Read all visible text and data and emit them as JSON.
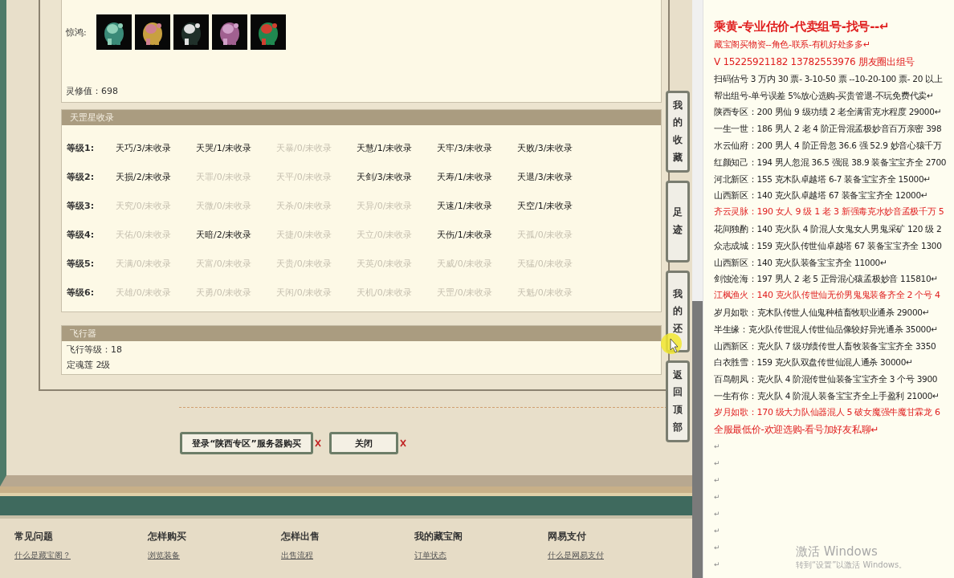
{
  "profile": {
    "set_label": "惊鸿:",
    "spirit": "灵修值：698"
  },
  "collection": {
    "title": "天罡星收录",
    "rows": [
      {
        "label": "等级1:",
        "cells": [
          {
            "text": "天巧/3/未收录",
            "collected": true
          },
          {
            "text": "天哭/1/未收录",
            "collected": true
          },
          {
            "text": "天暴/0/未收录",
            "collected": false
          },
          {
            "text": "天慧/1/未收录",
            "collected": true
          },
          {
            "text": "天牢/3/未收录",
            "collected": true
          },
          {
            "text": "天败/3/未收录",
            "collected": true
          }
        ]
      },
      {
        "label": "等级2:",
        "cells": [
          {
            "text": "天损/2/未收录",
            "collected": true
          },
          {
            "text": "天罪/0/未收录",
            "collected": false
          },
          {
            "text": "天平/0/未收录",
            "collected": false
          },
          {
            "text": "天剑/3/未收录",
            "collected": true
          },
          {
            "text": "天寿/1/未收录",
            "collected": true
          },
          {
            "text": "天退/3/未收录",
            "collected": true
          }
        ]
      },
      {
        "label": "等级3:",
        "cells": [
          {
            "text": "天究/0/未收录",
            "collected": false
          },
          {
            "text": "天微/0/未收录",
            "collected": false
          },
          {
            "text": "天杀/0/未收录",
            "collected": false
          },
          {
            "text": "天异/0/未收录",
            "collected": false
          },
          {
            "text": "天速/1/未收录",
            "collected": true
          },
          {
            "text": "天空/1/未收录",
            "collected": true
          }
        ]
      },
      {
        "label": "等级4:",
        "cells": [
          {
            "text": "天佑/0/未收录",
            "collected": false
          },
          {
            "text": "天暗/2/未收录",
            "collected": true
          },
          {
            "text": "天捷/0/未收录",
            "collected": false
          },
          {
            "text": "天立/0/未收录",
            "collected": false
          },
          {
            "text": "天伤/1/未收录",
            "collected": true
          },
          {
            "text": "天孤/0/未收录",
            "collected": false
          }
        ]
      },
      {
        "label": "等级5:",
        "cells": [
          {
            "text": "天满/0/未收录",
            "collected": false
          },
          {
            "text": "天富/0/未收录",
            "collected": false
          },
          {
            "text": "天贵/0/未收录",
            "collected": false
          },
          {
            "text": "天英/0/未收录",
            "collected": false
          },
          {
            "text": "天威/0/未收录",
            "collected": false
          },
          {
            "text": "天猛/0/未收录",
            "collected": false
          }
        ]
      },
      {
        "label": "等级6:",
        "cells": [
          {
            "text": "天雄/0/未收录",
            "collected": false
          },
          {
            "text": "天勇/0/未收录",
            "collected": false
          },
          {
            "text": "天闲/0/未收录",
            "collected": false
          },
          {
            "text": "天机/0/未收录",
            "collected": false
          },
          {
            "text": "天罡/0/未收录",
            "collected": false
          },
          {
            "text": "天魁/0/未收录",
            "collected": false
          }
        ]
      }
    ]
  },
  "aircraft": {
    "title": "飞行器",
    "lines": [
      "飞行等级：18",
      "定魂莲   2级"
    ]
  },
  "buttons": [
    "登录“陕西专区”服务器购买",
    "关闭"
  ],
  "side_tabs": [
    "我的收藏",
    "足迹",
    "我的还",
    "返回顶部"
  ],
  "footer": [
    {
      "heading": "常见问题",
      "link": "什么是藏宝阁？"
    },
    {
      "heading": "怎样购买",
      "link": "浏览装备"
    },
    {
      "heading": "怎样出售",
      "link": "出售流程"
    },
    {
      "heading": "我的藏宝阁",
      "link": "订单状态"
    },
    {
      "heading": "网易支付",
      "link": "什么是网易支付"
    }
  ],
  "document": {
    "lines": [
      {
        "kind": "title",
        "text": "乘黄-专业估价-代卖组号-找号--↵"
      },
      {
        "kind": "red",
        "text": "藏宝阁买物资--角色-联系-有机好处多多↵"
      },
      {
        "kind": "red-large",
        "text": "V 15225921182   13782553976 朋友圈出组号"
      },
      {
        "kind": "plain",
        "text": "扫码估号 3 万内 30 票- 3-10-50 票  --10-20-100 票- 20 以上"
      },
      {
        "kind": "plain",
        "text": "帮出组号-单号误差 5%放心选购-买贵管退-不玩免费代卖↵"
      },
      {
        "kind": "plain",
        "text": "陕西专区：200 男仙 9 级功绩 2 老全满雷克水程度 29000↵"
      },
      {
        "kind": "plain",
        "text": "一生一世：186 男人 2 老 4 阶正骨混孟极妙音百万亲密 398"
      },
      {
        "kind": "plain",
        "text": "水云仙府：200 男人 4 阶正骨忽 36.6 强 52.9 妙音心猿千万"
      },
      {
        "kind": "plain",
        "text": "红颜知己：194 男人忽混 36.5 强混 38.9 装备宝宝齐全 2700"
      },
      {
        "kind": "plain",
        "text": "河北新区：155 克木队卓越塔 6-7 装备宝宝齐全 15000↵"
      },
      {
        "kind": "plain",
        "text": "山西新区：140 克火队卓越塔 67 装备宝宝齐全 12000↵"
      },
      {
        "kind": "red",
        "text": "齐云灵脉：190 女人 9 级 1 老 3 新强毒克水妙音孟极千万 5"
      },
      {
        "kind": "plain",
        "text": "花间独酌：140 克火队 4 阶混人女鬼女人男鬼采矿 120 级 2"
      },
      {
        "kind": "plain",
        "text": "众志成城：159 克火队传世仙卓越塔 67 装备宝宝齐全 1300"
      },
      {
        "kind": "plain",
        "text": "山西新区：140 克火队装备宝宝齐全 11000↵"
      },
      {
        "kind": "plain",
        "text": "剑蚀沧海：197 男人 2 老 5 正骨混心猿孟极妙音 115810↵"
      },
      {
        "kind": "red",
        "text": "江枫渔火：140 克火队传世仙无价男鬼鬼装备齐全 2 个号 4"
      },
      {
        "kind": "plain",
        "text": "岁月如歌：克木队传世人仙鬼种植畜牧职业通杀 29000↵"
      },
      {
        "kind": "plain",
        "text": "半生缘：克火队传世混人传世仙品像较好异光通杀 35000↵"
      },
      {
        "kind": "plain",
        "text": "山西新区：克火队 7 级功绩传世人畜牧装备宝宝齐全 3350"
      },
      {
        "kind": "plain",
        "text": "白衣胜雪：159 克火队双盘传世仙混人通杀 30000↵"
      },
      {
        "kind": "plain",
        "text": "百鸟朝凤：克火队 4 阶混传世仙装备宝宝齐全 3 个号 3900"
      },
      {
        "kind": "plain",
        "text": "一生有你：克火队 4 阶混人装备宝宝齐全上手盈利 21000↵"
      },
      {
        "kind": "red",
        "text": "岁月如歌：170 级大力队仙器混人 5 破女魔强牛魔甘霖龙 6"
      },
      {
        "kind": "red-large",
        "text": "全服最低价-欢迎选购-看号加好友私聊↵"
      }
    ],
    "empty_marks": [
      "↵",
      "↵",
      "↵",
      "↵",
      "↵",
      "↵",
      "↵",
      "↵"
    ]
  },
  "activation_notice": {
    "title": "激活 Windows",
    "text": "转到“设置”以激活 Windows。"
  }
}
